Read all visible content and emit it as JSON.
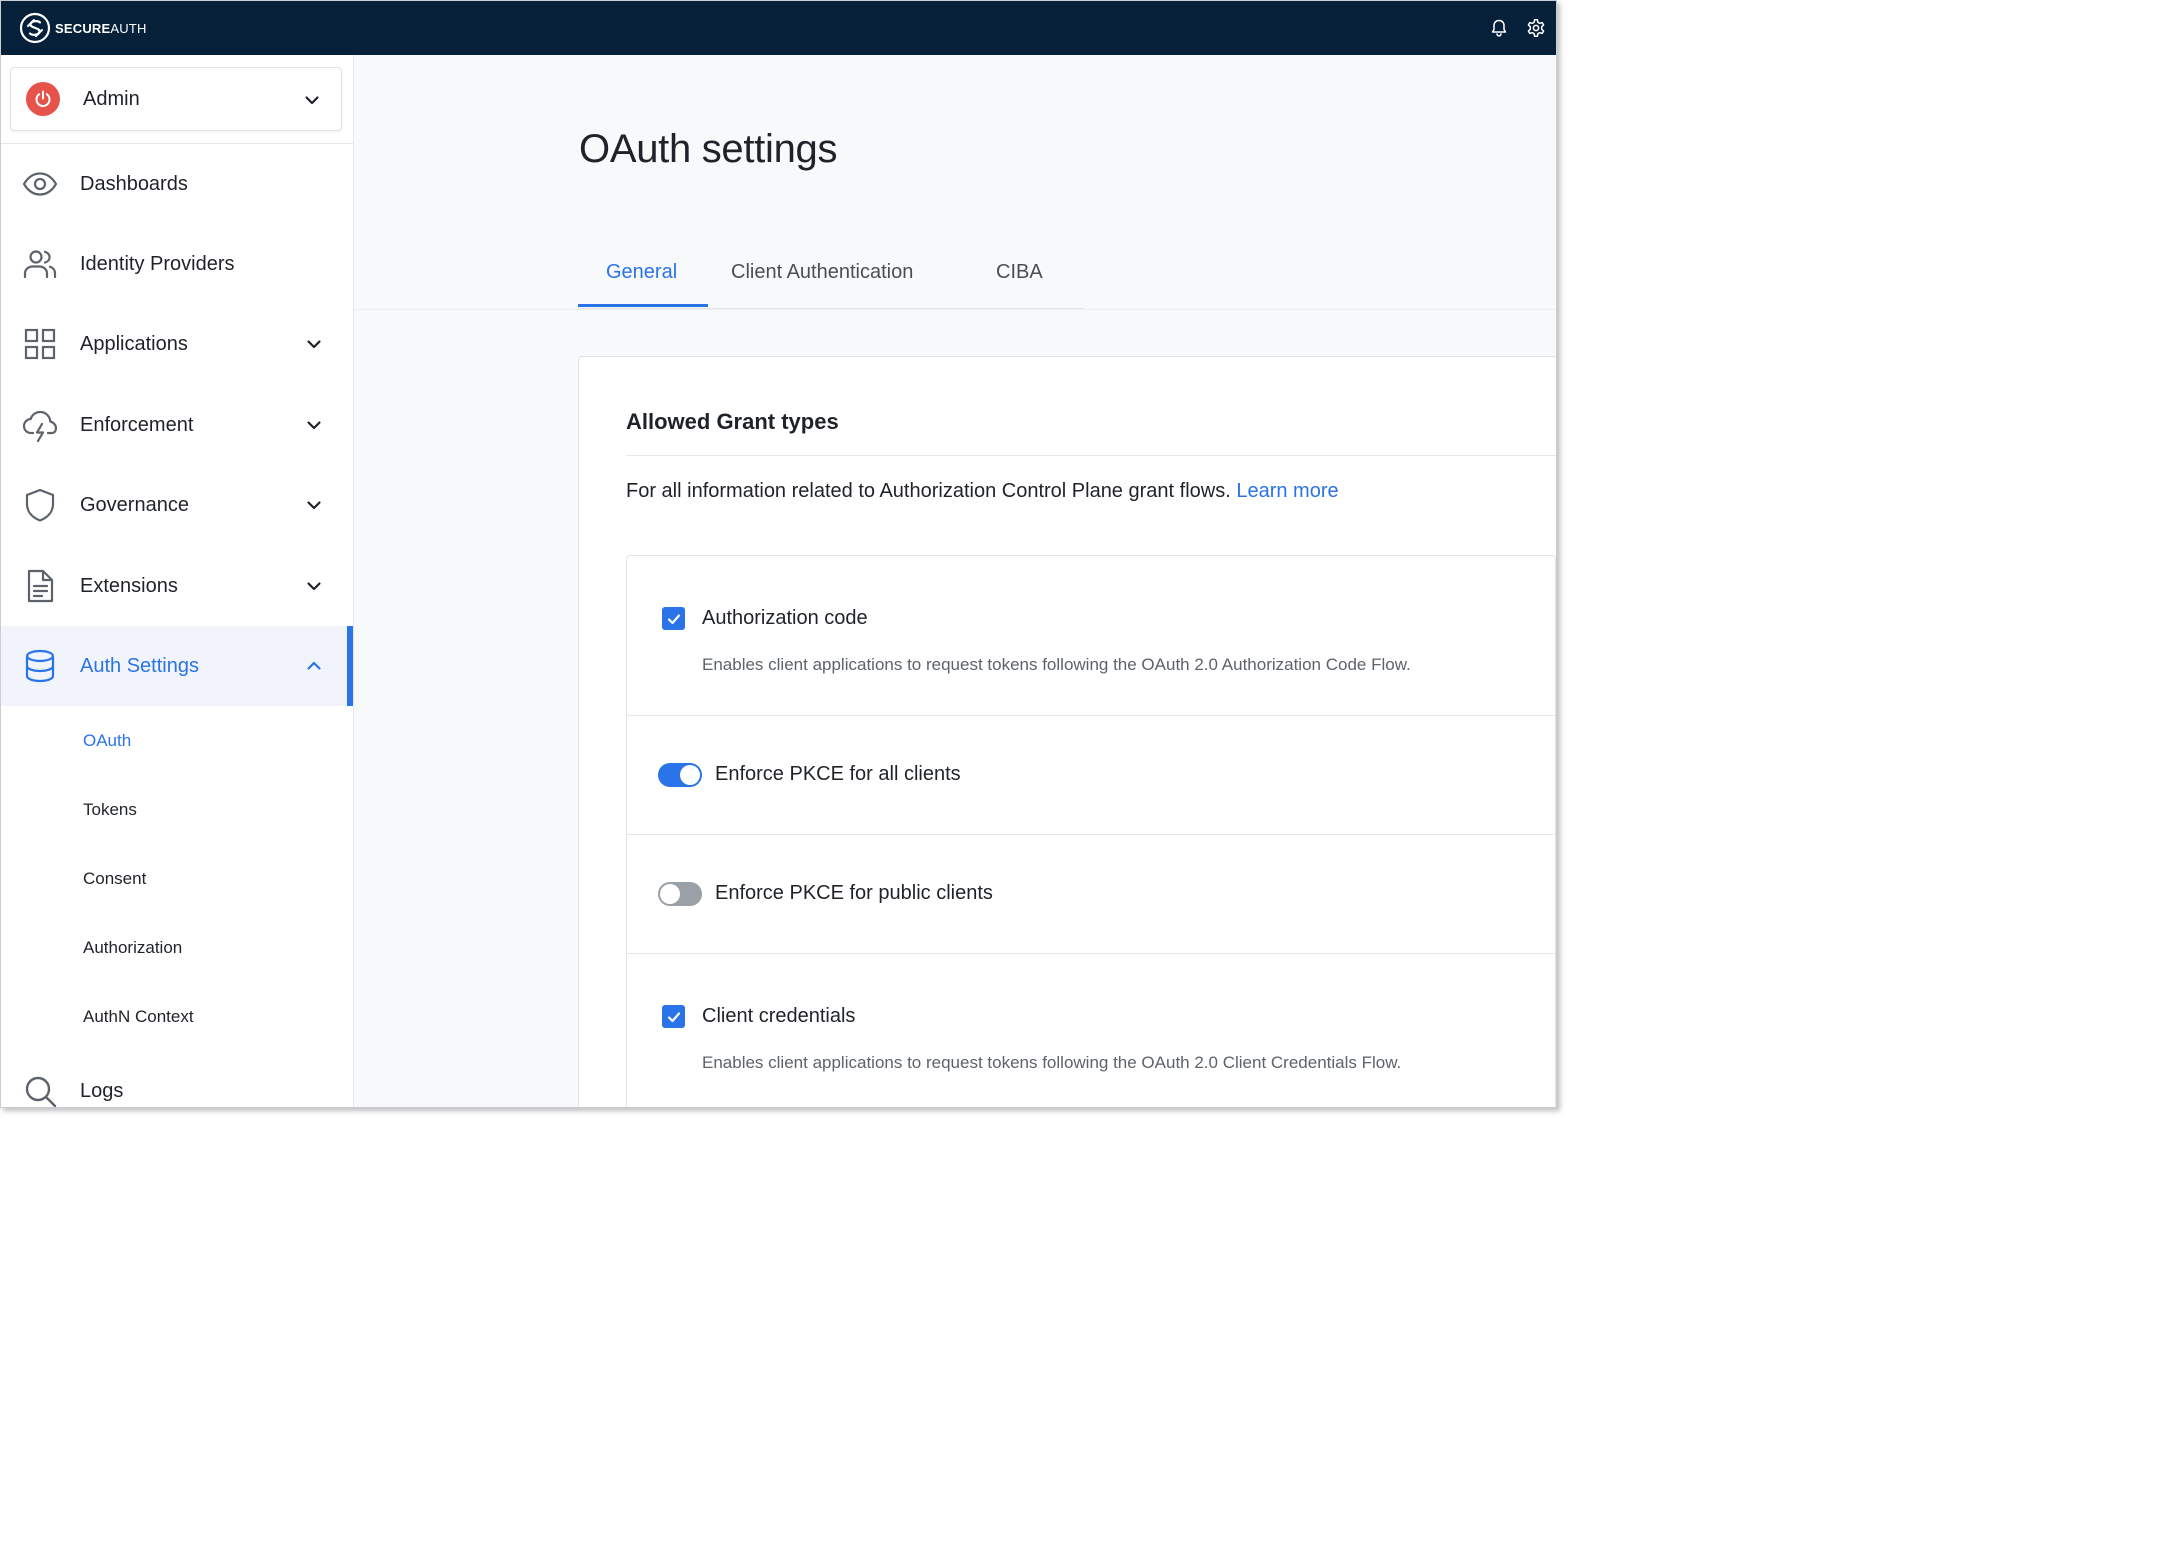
{
  "brand": {
    "strong": "SECURE",
    "light": "AUTH",
    "icon": "secureauth-logo"
  },
  "topbar": {
    "icons": [
      "bell-icon",
      "gear-icon"
    ]
  },
  "sidebar": {
    "org": {
      "label": "Admin",
      "icon": "power-icon",
      "accent": "#e5534b"
    },
    "items": [
      {
        "label": "Dashboards",
        "icon": "eye-icon",
        "expandable": false
      },
      {
        "label": "Identity Providers",
        "icon": "users-icon",
        "expandable": false
      },
      {
        "label": "Applications",
        "icon": "grid-icon",
        "expandable": true
      },
      {
        "label": "Enforcement",
        "icon": "cloud-lightning-icon",
        "expandable": true
      },
      {
        "label": "Governance",
        "icon": "shield-icon",
        "expandable": true
      },
      {
        "label": "Extensions",
        "icon": "document-icon",
        "expandable": true
      },
      {
        "label": "Auth Settings",
        "icon": "database-icon",
        "expandable": true,
        "expanded": true,
        "active": true
      },
      {
        "label": "Logs",
        "icon": "search-icon",
        "expandable": false
      }
    ],
    "sub_items": [
      {
        "label": "OAuth",
        "active": true
      },
      {
        "label": "Tokens"
      },
      {
        "label": "Consent"
      },
      {
        "label": "Authorization"
      },
      {
        "label": "AuthN Context"
      }
    ]
  },
  "main": {
    "title": "OAuth settings",
    "tabs": [
      {
        "label": "General",
        "active": true
      },
      {
        "label": "Client Authentication"
      },
      {
        "label": "CIBA"
      }
    ],
    "card": {
      "title": "Allowed Grant types",
      "description": "For all information related to Authorization Control Plane grant flows.",
      "learn_more": "Learn more",
      "options": [
        {
          "type": "checkbox",
          "checked": true,
          "label": "Authorization code",
          "help": "Enables client applications to request tokens following the OAuth 2.0 Authorization Code Flow."
        },
        {
          "type": "toggle",
          "on": true,
          "label": "Enforce PKCE for all clients"
        },
        {
          "type": "toggle",
          "on": false,
          "label": "Enforce PKCE for public clients"
        },
        {
          "type": "checkbox",
          "checked": true,
          "label": "Client credentials",
          "help": "Enables client applications to request tokens following the OAuth 2.0 Client Credentials Flow."
        }
      ]
    }
  },
  "colors": {
    "topbar": "#062039",
    "accent": "#2a73e8",
    "danger": "#e5534b"
  }
}
